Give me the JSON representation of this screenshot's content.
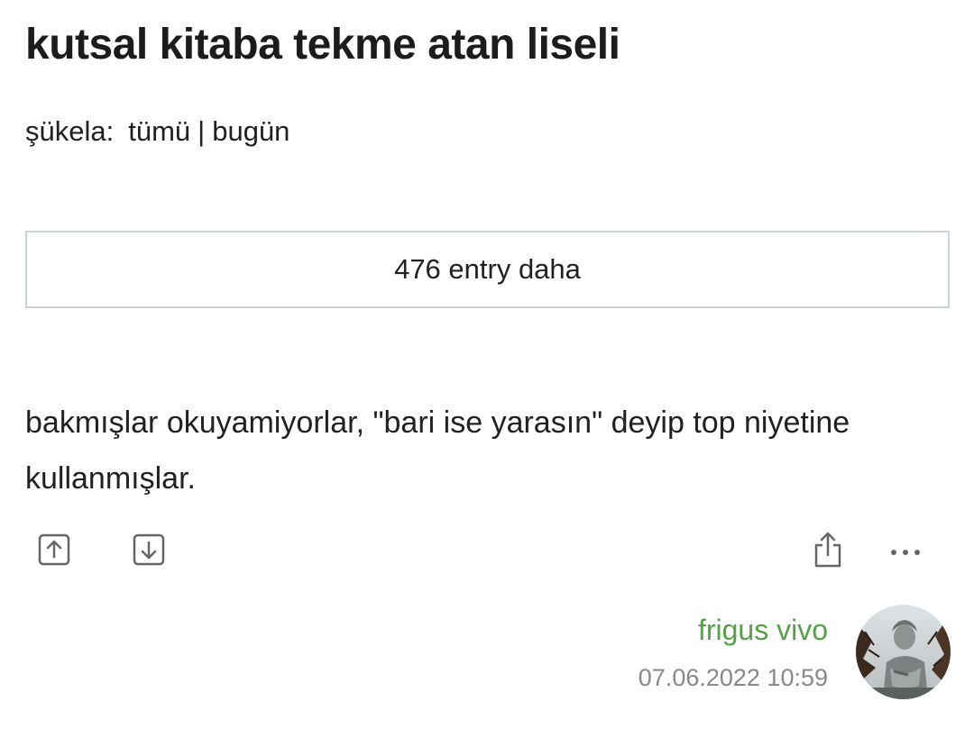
{
  "topic": {
    "title": "kutsal kitaba tekme atan liseli"
  },
  "filters": {
    "label": "şükela:",
    "all": "tümü",
    "separator": "|",
    "today": "bugün"
  },
  "more_entries": {
    "label": "476 entry daha"
  },
  "entry": {
    "text": "bakmışlar okuyamiyorlar, \"bari ise yarasın\" deyip top niyetine kullanmışlar.",
    "author": "frigus vivo",
    "date": "07.06.2022 10:59"
  },
  "actions": {
    "upvote_icon": "arrow-up-box-icon",
    "downvote_icon": "arrow-down-box-icon",
    "share_icon": "share-icon",
    "more_icon": "ellipsis-icon"
  },
  "colors": {
    "author": "#53a245",
    "date": "#888888",
    "border": "#c9d1d9",
    "text": "#212121"
  }
}
